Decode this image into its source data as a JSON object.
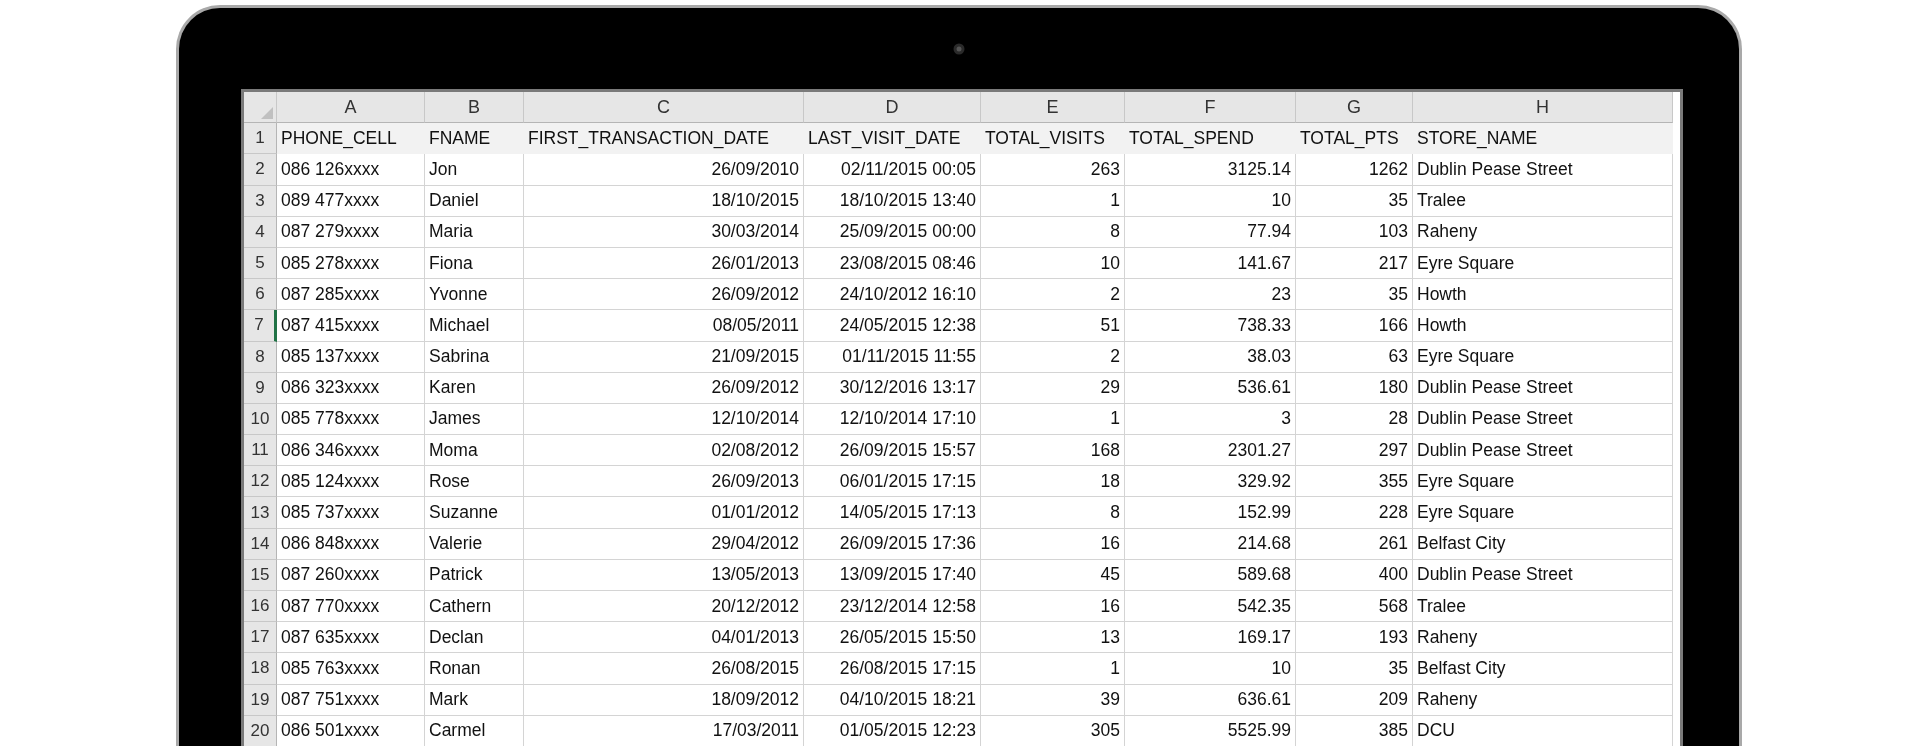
{
  "columns": [
    {
      "letter": "A",
      "kind": "text"
    },
    {
      "letter": "B",
      "kind": "text"
    },
    {
      "letter": "C",
      "kind": "number"
    },
    {
      "letter": "D",
      "kind": "number"
    },
    {
      "letter": "E",
      "kind": "number"
    },
    {
      "letter": "F",
      "kind": "number"
    },
    {
      "letter": "G",
      "kind": "number"
    },
    {
      "letter": "H",
      "kind": "text"
    }
  ],
  "rows": [
    {
      "number": "1",
      "kind": "header",
      "selected": false,
      "cells": [
        "PHONE_CELL",
        "FNAME",
        "FIRST_TRANSACTION_DATE",
        "LAST_VISIT_DATE",
        "TOTAL_VISITS",
        "TOTAL_SPEND",
        "TOTAL_PTS",
        "STORE_NAME"
      ]
    },
    {
      "number": "2",
      "kind": "data",
      "selected": false,
      "cells": [
        "086 126xxxx",
        "Jon",
        "26/09/2010",
        "02/11/2015 00:05",
        "263",
        "3125.14",
        "1262",
        "Dublin Pease Street"
      ]
    },
    {
      "number": "3",
      "kind": "data",
      "selected": false,
      "cells": [
        "089 477xxxx",
        "Daniel",
        "18/10/2015",
        "18/10/2015 13:40",
        "1",
        "10",
        "35",
        "Tralee"
      ]
    },
    {
      "number": "4",
      "kind": "data",
      "selected": false,
      "cells": [
        "087 279xxxx",
        "Maria",
        "30/03/2014",
        "25/09/2015 00:00",
        "8",
        "77.94",
        "103",
        "Raheny"
      ]
    },
    {
      "number": "5",
      "kind": "data",
      "selected": false,
      "cells": [
        "085 278xxxx",
        "Fiona",
        "26/01/2013",
        "23/08/2015 08:46",
        "10",
        "141.67",
        "217",
        "Eyre Square"
      ]
    },
    {
      "number": "6",
      "kind": "data",
      "selected": false,
      "cells": [
        "087 285xxxx",
        "Yvonne",
        "26/09/2012",
        "24/10/2012 16:10",
        "2",
        "23",
        "35",
        "Howth"
      ]
    },
    {
      "number": "7",
      "kind": "data",
      "selected": true,
      "cells": [
        "087 415xxxx",
        "Michael",
        "08/05/2011",
        "24/05/2015 12:38",
        "51",
        "738.33",
        "166",
        "Howth"
      ]
    },
    {
      "number": "8",
      "kind": "data",
      "selected": false,
      "cells": [
        "085 137xxxx",
        "Sabrina",
        "21/09/2015",
        "01/11/2015 11:55",
        "2",
        "38.03",
        "63",
        "Eyre Square"
      ]
    },
    {
      "number": "9",
      "kind": "data",
      "selected": false,
      "cells": [
        "086 323xxxx",
        "Karen",
        "26/09/2012",
        "30/12/2016 13:17",
        "29",
        "536.61",
        "180",
        "Dublin Pease Street"
      ]
    },
    {
      "number": "10",
      "kind": "data",
      "selected": false,
      "cells": [
        "085 778xxxx",
        "James",
        "12/10/2014",
        "12/10/2014 17:10",
        "1",
        "3",
        "28",
        "Dublin Pease Street"
      ]
    },
    {
      "number": "11",
      "kind": "data",
      "selected": false,
      "cells": [
        "086 346xxxx",
        "Moma",
        "02/08/2012",
        "26/09/2015 15:57",
        "168",
        "2301.27",
        "297",
        "Dublin Pease Street"
      ]
    },
    {
      "number": "12",
      "kind": "data",
      "selected": false,
      "cells": [
        "085 124xxxx",
        "Rose",
        "26/09/2013",
        "06/01/2015 17:15",
        "18",
        "329.92",
        "355",
        "Eyre Square"
      ]
    },
    {
      "number": "13",
      "kind": "data",
      "selected": false,
      "cells": [
        "085 737xxxx",
        "Suzanne",
        "01/01/2012",
        "14/05/2015 17:13",
        "8",
        "152.99",
        "228",
        "Eyre Square"
      ]
    },
    {
      "number": "14",
      "kind": "data",
      "selected": false,
      "cells": [
        "086 848xxxx",
        "Valerie",
        "29/04/2012",
        "26/09/2015 17:36",
        "16",
        "214.68",
        "261",
        "Belfast City"
      ]
    },
    {
      "number": "15",
      "kind": "data",
      "selected": false,
      "cells": [
        "087 260xxxx",
        "Patrick",
        "13/05/2013",
        "13/09/2015 17:40",
        "45",
        "589.68",
        "400",
        "Dublin Pease Street"
      ]
    },
    {
      "number": "16",
      "kind": "data",
      "selected": false,
      "cells": [
        "087 770xxxx",
        "Cathern",
        "20/12/2012",
        "23/12/2014 12:58",
        "16",
        "542.35",
        "568",
        "Tralee"
      ]
    },
    {
      "number": "17",
      "kind": "data",
      "selected": false,
      "cells": [
        "087 635xxxx",
        "Declan",
        "04/01/2013",
        "26/05/2015 15:50",
        "13",
        "169.17",
        "193",
        "Raheny"
      ]
    },
    {
      "number": "18",
      "kind": "data",
      "selected": false,
      "cells": [
        "085 763xxxx",
        "Ronan",
        "26/08/2015",
        "26/08/2015 17:15",
        "1",
        "10",
        "35",
        "Belfast City"
      ]
    },
    {
      "number": "19",
      "kind": "data",
      "selected": false,
      "cells": [
        "087 751xxxx",
        "Mark",
        "18/09/2012",
        "04/10/2015 18:21",
        "39",
        "636.61",
        "209",
        "Raheny"
      ]
    },
    {
      "number": "20",
      "kind": "data",
      "selected": false,
      "cells": [
        "086 501xxxx",
        "Carmel",
        "17/03/2011",
        "01/05/2015 12:23",
        "305",
        "5525.99",
        "385",
        "DCU"
      ]
    }
  ]
}
